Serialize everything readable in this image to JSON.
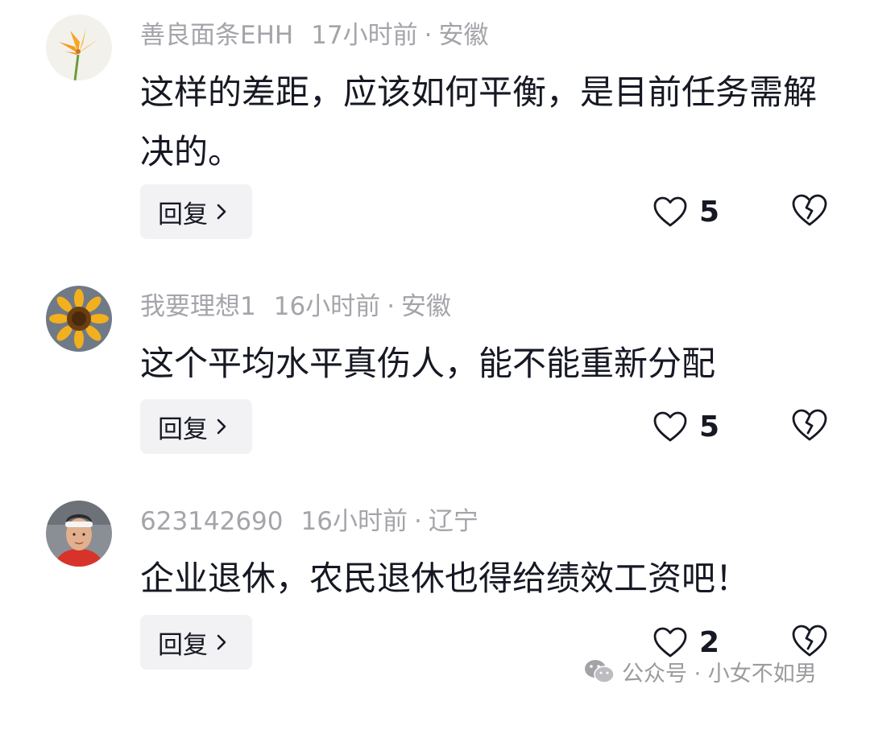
{
  "comments": [
    {
      "username": "善良面条EHH",
      "time": "17小时前",
      "separator": "·",
      "location": "安徽",
      "text": "这样的差距，应该如何平衡，是目前任务需解决的。",
      "reply_label": "回复",
      "likes": "5",
      "avatar": "orange-lily-flower"
    },
    {
      "username": "我要理想1",
      "time": "16小时前",
      "separator": "·",
      "location": "安徽",
      "text": "这个平均水平真伤人，能不能重新分配",
      "reply_label": "回复",
      "likes": "5",
      "avatar": "sunflower"
    },
    {
      "username": "623142690",
      "time": "16小时前",
      "separator": "·",
      "location": "辽宁",
      "text": "企业退休，农民退休也得给绩效工资吧！",
      "reply_label": "回复",
      "likes": "2",
      "avatar": "man-with-headband"
    }
  ],
  "watermark": {
    "icon": "wechat-icon",
    "text": "公众号 · 小女不如男"
  }
}
